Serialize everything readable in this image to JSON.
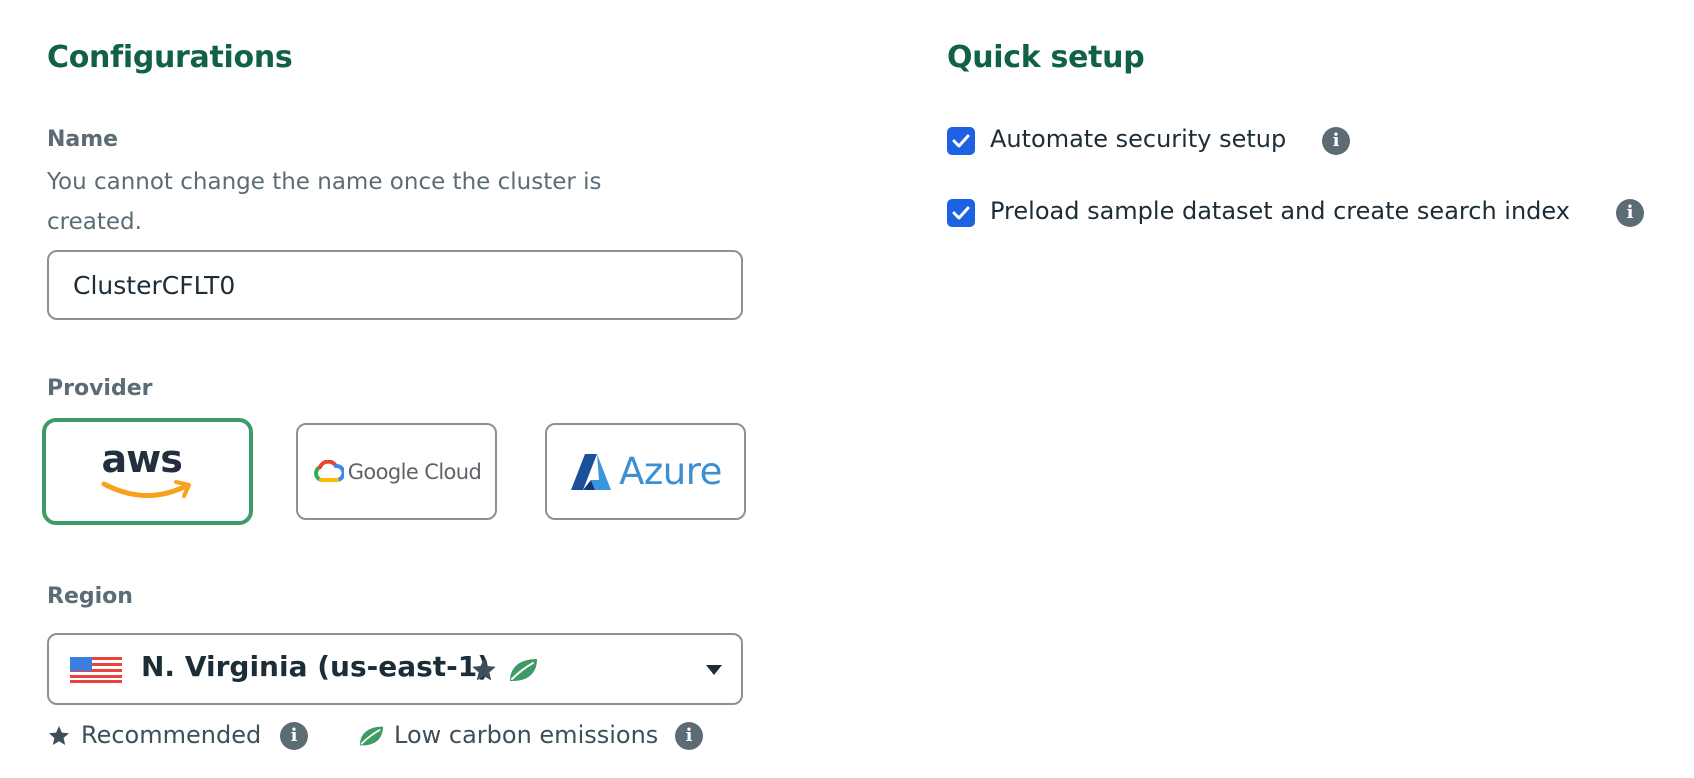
{
  "configurations": {
    "title": "Configurations",
    "name": {
      "label": "Name",
      "help_text": "You cannot change the name once the cluster is created.",
      "value": "ClusterCFLT0"
    },
    "provider": {
      "label": "Provider",
      "options": [
        {
          "label": "aws",
          "icon": "aws-logo-icon",
          "selected": true
        },
        {
          "label": "Google Cloud",
          "icon": "google-cloud-logo-icon",
          "selected": false
        },
        {
          "label": "Azure",
          "icon": "azure-logo-icon",
          "selected": false
        }
      ]
    },
    "region": {
      "label": "Region",
      "selected": "N. Virginia (us-east-1)",
      "flag_icon": "us-flag-icon",
      "badges": [
        "star-icon",
        "leaf-icon"
      ]
    },
    "legend": {
      "recommended": "Recommended",
      "low_carbon": "Low carbon emissions"
    }
  },
  "quick_setup": {
    "title": "Quick setup",
    "options": [
      {
        "label": "Automate security setup",
        "checked": true
      },
      {
        "label": "Preload sample dataset and create search index",
        "checked": true
      }
    ]
  },
  "colors": {
    "heading": "#116149",
    "selected_border": "#3d9b63",
    "checkbox": "#1e62e3",
    "leaf": "#3d9b63",
    "info_icon": "#5c6c75"
  }
}
